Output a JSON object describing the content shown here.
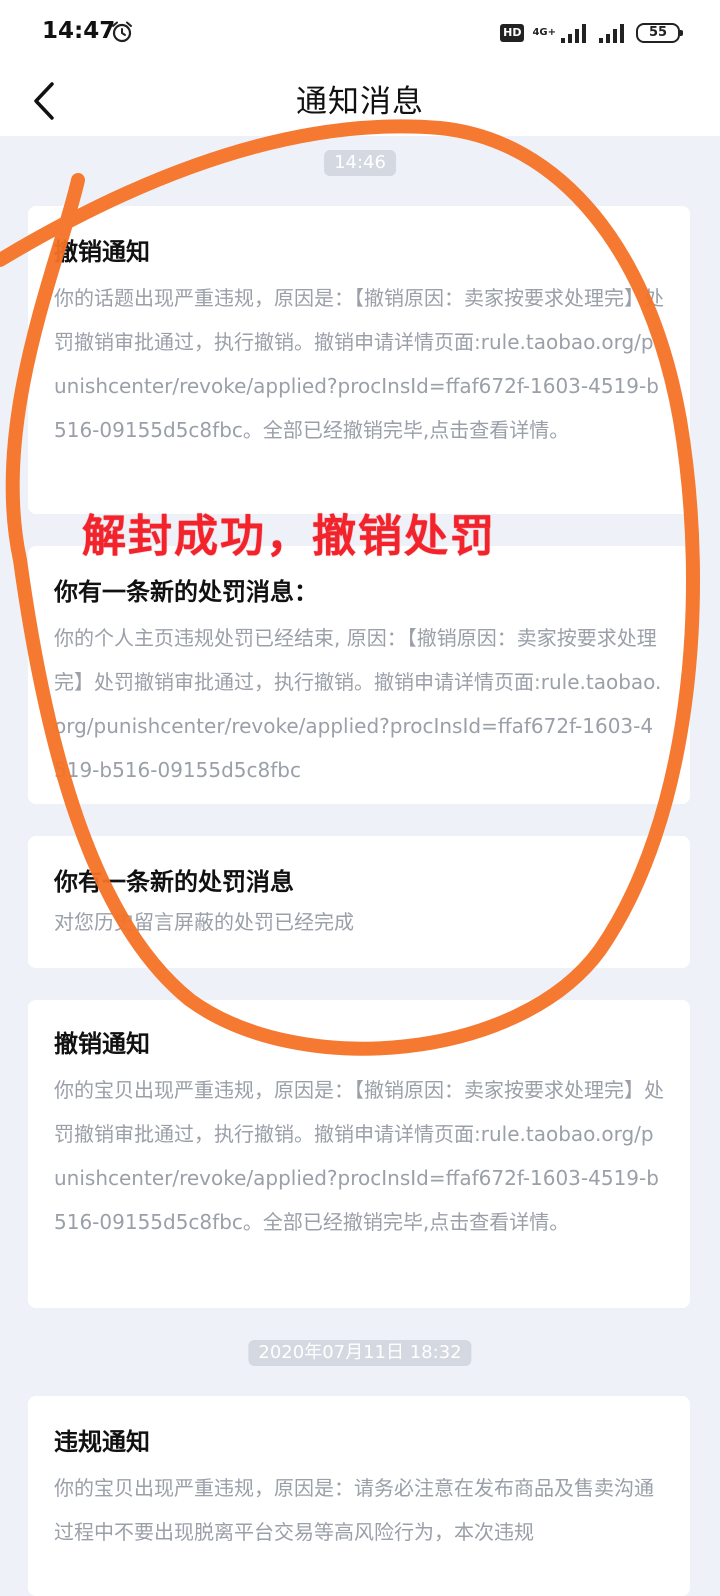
{
  "status_bar": {
    "time": "14:47",
    "hd_label": "HD",
    "network_label": "4G+",
    "battery_level": "55"
  },
  "nav": {
    "title": "通知消息"
  },
  "messages": [
    {
      "time_chip": "14:46",
      "title": "撤销通知",
      "body": "你的话题出现严重违规，原因是：【撤销原因：卖家按要求处理完】处罚撤销审批通过，执行撤销。撤销申请详情页面:rule.taobao.org/punishcenter/revoke/applied?procInsId=ffaf672f-1603-4519-b516-09155d5c8fbc。全部已经撤销完毕,点击查看详情。"
    },
    {
      "title": "你有一条新的处罚消息：",
      "body": "你的个人主页违规处罚已经结束, 原因：【撤销原因：卖家按要求处理完】处罚撤销审批通过，执行撤销。撤销申请详情页面:rule.taobao.org/punishcenter/revoke/applied?procInsId=ffaf672f-1603-4519-b516-09155d5c8fbc"
    },
    {
      "title": "你有一条新的处罚消息",
      "body": "对您历史留言屏蔽的处罚已经完成"
    },
    {
      "title": "撤销通知",
      "body": "你的宝贝出现严重违规，原因是：【撤销原因：卖家按要求处理完】处罚撤销审批通过，执行撤销。撤销申请详情页面:rule.taobao.org/punishcenter/revoke/applied?procInsId=ffaf672f-1603-4519-b516-09155d5c8fbc。全部已经撤销完毕,点击查看详情。"
    },
    {
      "time_chip": "2020年07月11日 18:32",
      "title": "违规通知",
      "body": "你的宝贝出现严重违规，原因是：请务必注意在发布商品及售卖沟通过程中不要出现脱离平台交易等高风险行为，本次违规"
    }
  ],
  "annotation": {
    "text": "解封成功，撤销处罚",
    "text_color": "#f2232b",
    "circle_color": "#f47226"
  }
}
